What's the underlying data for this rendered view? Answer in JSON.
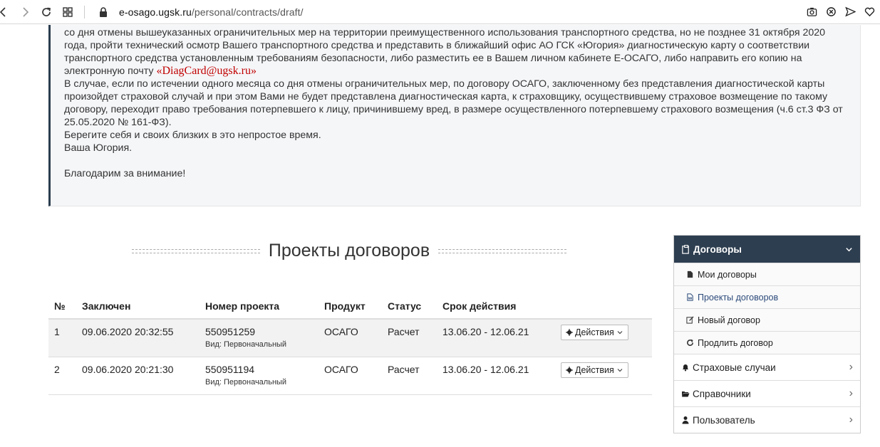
{
  "browser": {
    "url_domain": "e-osago.ugsk.ru",
    "url_path": "/personal/contracts/draft/"
  },
  "notice": {
    "line1": "со дня отмены вышеуказанных ограничительных мер на территории преимущественного использования транспортного средства, но не позднее 31 октября 2020 года, пройти технический осмотр Вашего транспортного средства и представить в ближайший офис АО ГСК «Югория» диагностическую карту о соответствии транспортного средства установленным требованиям безопасности, либо разместить ее в Вашем личном кабинете Е-ОСАГО, либо направить его копию на электронную почту",
    "email": "«DiagCard@ugsk.ru»",
    "para2": "В случае, если по истечении одного месяца со дня отмены ограничительных мер, по договору ОСАГО, заключенному без представления диагностической карты произойдет страховой случай и при этом Вами не будет представлена диагностическая карта, к страховщику, осуществившему страховое возмещение по такому договору, переходит право требования потерпевшего к лицу, причинившему вред, в размере осуществленного потерпевшему страхового возмещения (ч.6 ст.3 ФЗ от 25.05.2020 № 161-ФЗ).",
    "para3": "Берегите себя и своих близких в это непростое время.",
    "para4": "Ваша Югория.",
    "para5": "Благодарим за внимание!"
  },
  "section_title": "Проекты договоров",
  "table": {
    "headers": [
      "№",
      "Заключен",
      "Номер проекта",
      "Продукт",
      "Статус",
      "Срок действия"
    ],
    "rows": [
      {
        "num": "1",
        "date": "09.06.2020 20:32:55",
        "project": "550951259",
        "kind": "Вид: Первоначальный",
        "product": "ОСАГО",
        "status": "Расчет",
        "term": "13.06.20 - 12.06.21",
        "action": "Действия"
      },
      {
        "num": "2",
        "date": "09.06.2020 20:21:30",
        "project": "550951194",
        "kind": "Вид: Первоначальный",
        "product": "ОСАГО",
        "status": "Расчет",
        "term": "13.06.20 - 12.06.21",
        "action": "Действия"
      }
    ]
  },
  "sidebar": {
    "header": "Договоры",
    "sub": [
      "Мои договоры",
      "Проекты договоров",
      "Новый договор",
      "Продлить договор"
    ],
    "items": [
      "Страховые случаи",
      "Справочники",
      "Пользователь"
    ]
  }
}
